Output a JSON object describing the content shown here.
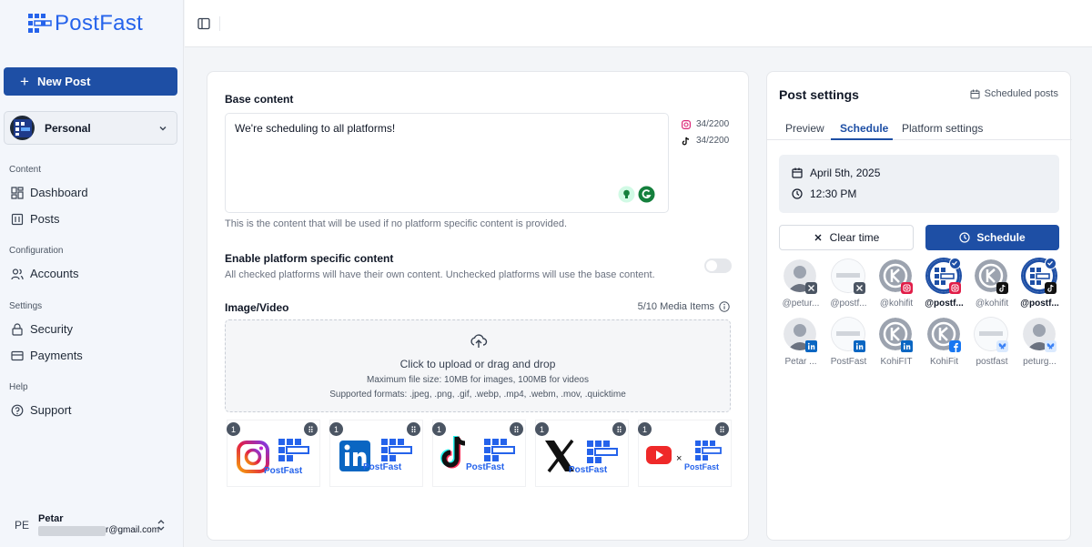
{
  "brand": {
    "name": "PostFast",
    "accent": "#2563eb",
    "primary": "#1e4fa5"
  },
  "sidebar": {
    "new_post_label": "New Post",
    "workspace": "Personal",
    "sections": [
      {
        "title": "Content",
        "items": [
          {
            "label": "Dashboard",
            "icon": "dashboard-icon"
          },
          {
            "label": "Posts",
            "icon": "posts-icon"
          }
        ]
      },
      {
        "title": "Configuration",
        "items": [
          {
            "label": "Accounts",
            "icon": "users-icon"
          }
        ]
      },
      {
        "title": "Settings",
        "items": [
          {
            "label": "Security",
            "icon": "lock-icon"
          },
          {
            "label": "Payments",
            "icon": "card-icon"
          }
        ]
      },
      {
        "title": "Help",
        "items": [
          {
            "label": "Support",
            "icon": "help-icon"
          }
        ]
      }
    ],
    "user": {
      "initials": "PE",
      "name": "Petar",
      "email": "r@gmail.com"
    }
  },
  "content": {
    "base_label": "Base content",
    "base_text": "We're scheduling to all platforms!",
    "counters": [
      {
        "platform": "instagram-icon",
        "text": "34/2200"
      },
      {
        "platform": "tiktok-icon",
        "text": "34/2200"
      }
    ],
    "base_hint": "This is the content that will be used if no platform specific content is provided.",
    "platform_label": "Enable platform specific content",
    "platform_hint": "All checked platforms will have their own content. Unchecked platforms will use the base content.",
    "platform_enabled": false,
    "media_label": "Image/Video",
    "media_count": "5/10 Media Items",
    "dropzone": {
      "main": "Click to upload or drag and drop",
      "size": "Maximum file size: 10MB for images, 100MB for videos",
      "formats": "Supported formats: .jpeg, .png, .gif, .webp, .mp4, .webm, .mov, .quicktime"
    },
    "thumbnails": [
      {
        "index": "1",
        "platform": "instagram",
        "caption": "PostFast"
      },
      {
        "index": "1",
        "platform": "linkedin",
        "caption": "PostFast"
      },
      {
        "index": "1",
        "platform": "tiktok",
        "caption": "PostFast"
      },
      {
        "index": "1",
        "platform": "x",
        "caption": "PostFast"
      },
      {
        "index": "1",
        "platform": "youtube",
        "caption": "PostFast",
        "separator": "×"
      }
    ]
  },
  "settings": {
    "title": "Post settings",
    "scheduled_link": "Scheduled posts",
    "tabs": [
      "Preview",
      "Schedule",
      "Platform settings"
    ],
    "active_tab": "Schedule",
    "date": "April 5th, 2025",
    "time": "12:30 PM",
    "clear_label": "Clear time",
    "schedule_label": "Schedule",
    "accounts": [
      {
        "name": "@petur...",
        "avatar": "person",
        "platform": "x",
        "selected": false
      },
      {
        "name": "@postf...",
        "avatar": "postfast",
        "platform": "x",
        "selected": false
      },
      {
        "name": "@kohifit",
        "avatar": "kohi",
        "platform": "instagram",
        "selected": false
      },
      {
        "name": "@postf...",
        "avatar": "postfast-blue",
        "platform": "instagram",
        "selected": true
      },
      {
        "name": "@kohifit",
        "avatar": "kohi",
        "platform": "tiktok",
        "selected": false
      },
      {
        "name": "@postf...",
        "avatar": "postfast-blue",
        "platform": "tiktok",
        "selected": true
      },
      {
        "name": "Petar ...",
        "avatar": "person",
        "platform": "linkedin",
        "selected": false
      },
      {
        "name": "PostFast",
        "avatar": "postfast",
        "platform": "linkedin",
        "selected": false
      },
      {
        "name": "KohiFIT",
        "avatar": "kohi",
        "platform": "linkedin",
        "selected": false
      },
      {
        "name": "KohiFit",
        "avatar": "kohi",
        "platform": "facebook",
        "selected": false
      },
      {
        "name": "postfast",
        "avatar": "postfast",
        "platform": "bluesky",
        "selected": false
      },
      {
        "name": "peturg...",
        "avatar": "person",
        "platform": "bluesky",
        "selected": false
      }
    ]
  }
}
